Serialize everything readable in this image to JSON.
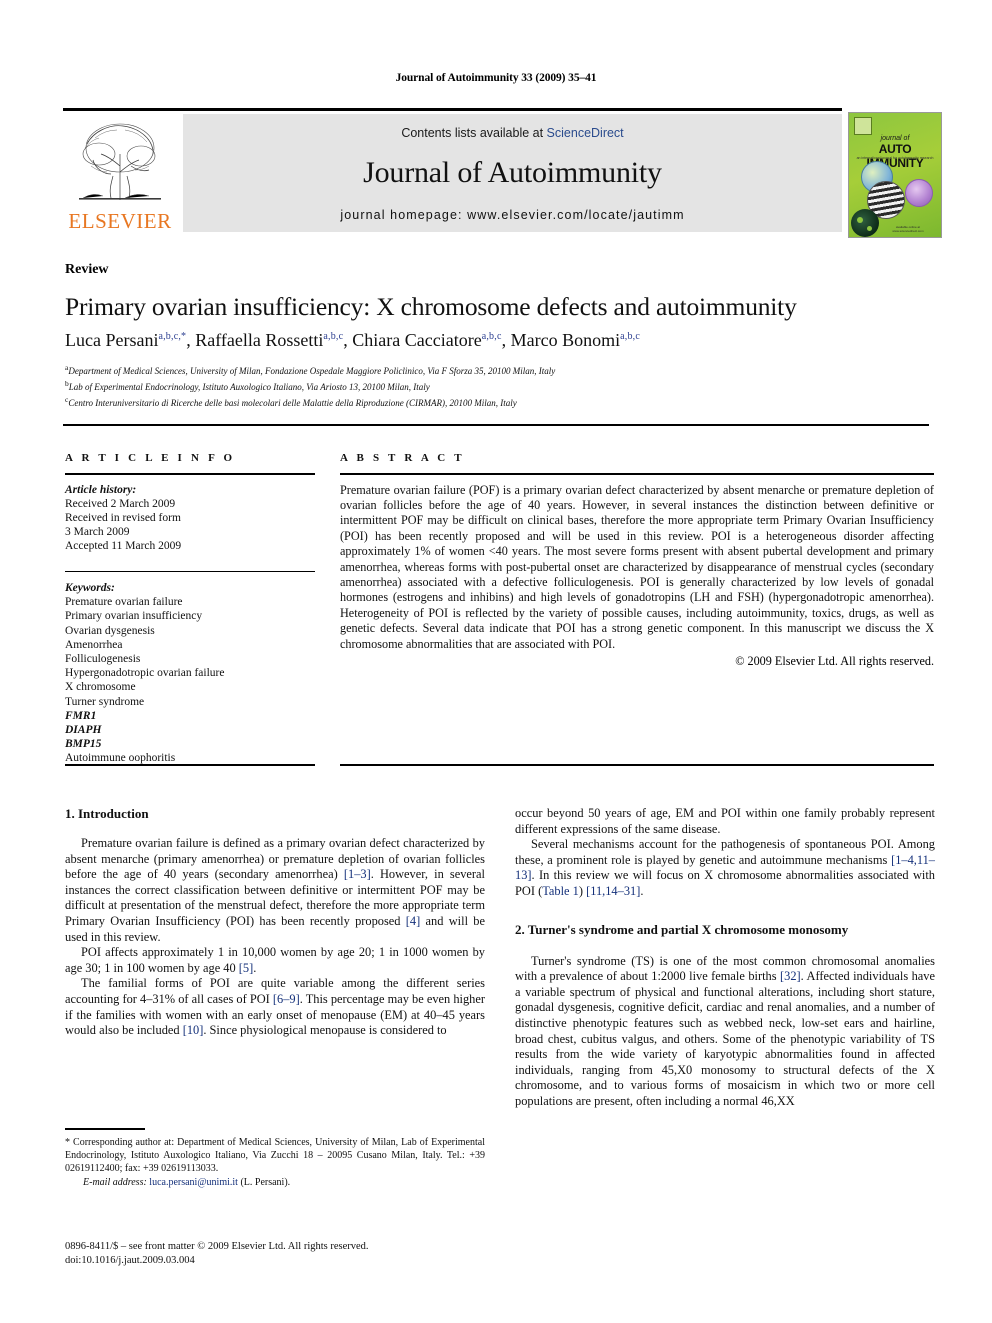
{
  "running_head": "Journal of Autoimmunity 33 (2009) 35–41",
  "masthead": {
    "publisher_name": "ELSEVIER",
    "contents_prefix": "Contents lists available at ",
    "contents_link": "ScienceDirect",
    "journal_title": "Journal of Autoimmunity",
    "homepage": "journal homepage: www.elsevier.com/locate/jautimm",
    "cover": {
      "journal_of": "journal of",
      "title": "AUTO IMMUNITY",
      "subtitle": "an international journal for autoimmunity research",
      "footer": "available online at www.sciencedirect.com"
    }
  },
  "article": {
    "type": "Review",
    "title": "Primary ovarian insufficiency: X chromosome defects and autoimmunity",
    "authors": [
      {
        "name": "Luca Persani",
        "sup": "a,b,c,*"
      },
      {
        "name": "Raffaella Rossetti",
        "sup": "a,b,c"
      },
      {
        "name": "Chiara Cacciatore",
        "sup": "a,b,c"
      },
      {
        "name": "Marco Bonomi",
        "sup": "a,b,c"
      }
    ],
    "affiliations": [
      {
        "mark": "a",
        "text": "Department of Medical Sciences, University of Milan, Fondazione Ospedale Maggiore Policlinico, Via F Sforza 35, 20100 Milan, Italy"
      },
      {
        "mark": "b",
        "text": "Lab of Experimental Endocrinology, Istituto Auxologico Italiano, Via Ariosto 13, 20100 Milan, Italy"
      },
      {
        "mark": "c",
        "text": "Centro Interuniversitario di Ricerche delle basi molecolari delle Malattie della Riproduzione (CIRMAR), 20100 Milan, Italy"
      }
    ]
  },
  "article_info": {
    "heading": "A R T I C L E   I N F O",
    "history_label": "Article history:",
    "history": [
      "Received 2 March 2009",
      "Received in revised form",
      "3 March 2009",
      "Accepted 11 March 2009"
    ],
    "keywords_label": "Keywords:",
    "keywords": [
      {
        "text": "Premature ovarian failure",
        "italic": false
      },
      {
        "text": "Primary ovarian insufficiency",
        "italic": false
      },
      {
        "text": "Ovarian dysgenesis",
        "italic": false
      },
      {
        "text": "Amenorrhea",
        "italic": false
      },
      {
        "text": "Folliculogenesis",
        "italic": false
      },
      {
        "text": "Hypergonadotropic ovarian failure",
        "italic": false
      },
      {
        "text": "X chromosome",
        "italic": false
      },
      {
        "text": "Turner syndrome",
        "italic": false
      },
      {
        "text": "FMR1",
        "italic": true
      },
      {
        "text": "DIAPH",
        "italic": true
      },
      {
        "text": "BMP15",
        "italic": true
      },
      {
        "text": "Autoimmune oophoritis",
        "italic": false
      }
    ]
  },
  "abstract": {
    "heading": "A B S T R A C T",
    "text": "Premature ovarian failure (POF) is a primary ovarian defect characterized by absent menarche or premature depletion of ovarian follicles before the age of 40 years. However, in several instances the distinction between definitive or intermittent POF may be difficult on clinical bases, therefore the more appropriate term Primary Ovarian Insufficiency (POI) has been recently proposed and will be used in this review. POI is a heterogeneous disorder affecting approximately 1% of women <40 years. The most severe forms present with absent pubertal development and primary amenorrhea, whereas forms with post-pubertal onset are characterized by disappearance of menstrual cycles (secondary amenorrhea) associated with a defective folliculogenesis. POI is generally characterized by low levels of gonadal hormones (estrogens and inhibins) and high levels of gonadotropins (LH and FSH) (hypergonadotropic amenorrhea). Heterogeneity of POI is reflected by the variety of possible causes, including autoimmunity, toxics, drugs, as well as genetic defects. Several data indicate that POI has a strong genetic component. In this manuscript we discuss the X chromosome abnormalities that are associated with POI.",
    "copyright": "© 2009 Elsevier Ltd. All rights reserved."
  },
  "body": {
    "left": {
      "section1_heading": "1. Introduction",
      "p1_a": "Premature ovarian failure is defined as a primary ovarian defect characterized by absent menarche (primary amenorrhea) or premature depletion of ovarian follicles before the age of 40 years (secondary amenorrhea) ",
      "p1_ref1": "[1–3]",
      "p1_b": ". However, in several instances the correct classification between definitive or intermittent POF may be difficult at presentation of the menstrual defect, therefore the more appropriate term Primary Ovarian Insufficiency (POI) has been recently proposed ",
      "p1_ref2": "[4]",
      "p1_c": " and will be used in this review.",
      "p2_a": "POI affects approximately 1 in 10,000 women by age 20; 1 in 1000 women by age 30; 1 in 100 women by age 40 ",
      "p2_ref1": "[5]",
      "p2_b": ".",
      "p3_a": "The familial forms of POI are quite variable among the different series accounting for 4–31% of all cases of POI ",
      "p3_ref1": "[6–9]",
      "p3_b": ". This percentage may be even higher if the families with women with an early onset of menopause (EM) at 40–45 years would also be included ",
      "p3_ref2": "[10]",
      "p3_c": ". Since physiological menopause is considered to"
    },
    "right": {
      "p1": "occur beyond 50 years of age, EM and POI within one family probably represent different expressions of the same disease.",
      "p2_a": "Several mechanisms account for the pathogenesis of spontaneous POI. Among these, a prominent role is played by genetic and autoimmune mechanisms ",
      "p2_ref1": "[1–4,11–13]",
      "p2_b": ". In this review we will focus on X chromosome abnormalities associated with POI (",
      "p2_ref2": "Table 1",
      "p2_c": ") ",
      "p2_ref3": "[11,14–31]",
      "p2_d": ".",
      "section2_heading": "2. Turner's syndrome and partial X chromosome monosomy",
      "p3_a": "Turner's syndrome (TS) is one of the most common chromosomal anomalies with a prevalence of about 1:2000 live female births ",
      "p3_ref1": "[32]",
      "p3_b": ". Affected individuals have a variable spectrum of physical and functional alterations, including short stature, gonadal dysgenesis, cognitive deficit, cardiac and renal anomalies, and a number of distinctive phenotypic features such as webbed neck, low-set ears and hairline, broad chest, cubitus valgus, and others. Some of the phenotypic variability of TS results from the wide variety of karyotypic abnormalities found in affected individuals, ranging from 45,X0 monosomy to structural defects of the X chromosome, and to various forms of mosaicism in which two or more cell populations are present, often including a normal 46,XX"
    }
  },
  "footnote": {
    "corresponding_a": "* Corresponding author at: Department of Medical Sciences, University of Milan, Lab of Experimental Endocrinology, Istituto Auxologico Italiano, Via Zucchi 18 – 20095 Cusano Milan, Italy. Tel.: +39 02619112400; fax: +39 02619113033.",
    "email_label": "E-mail address:",
    "email": "luca.persani@unimi.it",
    "email_owner": "(L. Persani)."
  },
  "colophon": {
    "line1": "0896-8411/$ – see front matter © 2009 Elsevier Ltd. All rights reserved.",
    "line2": "doi:10.1016/j.jaut.2009.03.004"
  },
  "colors": {
    "link": "#2a4b8d",
    "reference": "#14307a",
    "elsevier_orange": "#E87722",
    "banner_gray": "#e4e4e4"
  }
}
